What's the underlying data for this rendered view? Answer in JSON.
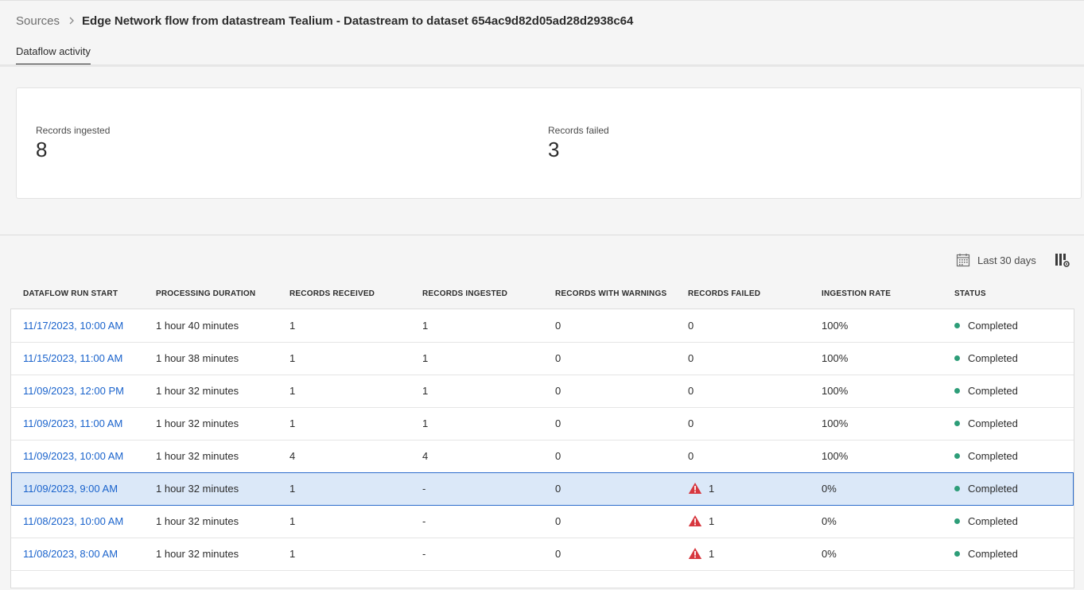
{
  "breadcrumb": {
    "root": "Sources",
    "current": "Edge Network flow from datastream Tealium - Datastream to dataset 654ac9d82d05ad28d2938c64"
  },
  "tabs": [
    {
      "label": "Dataflow activity",
      "active": true
    }
  ],
  "summary": {
    "records_ingested": {
      "label": "Records ingested",
      "value": "8"
    },
    "records_failed": {
      "label": "Records failed",
      "value": "3"
    }
  },
  "toolbar": {
    "date_range": "Last 30 days",
    "icons": [
      "calendar-icon",
      "column-settings-icon"
    ]
  },
  "table": {
    "columns": [
      "DATAFLOW RUN START",
      "PROCESSING DURATION",
      "RECORDS RECEIVED",
      "RECORDS INGESTED",
      "RECORDS WITH WARNINGS",
      "RECORDS FAILED",
      "INGESTION RATE",
      "STATUS"
    ],
    "rows": [
      {
        "start": "11/17/2023, 10:00 AM",
        "duration": "1 hour 40 minutes",
        "received": "1",
        "ingested": "1",
        "warnings": "0",
        "failed": "0",
        "failed_alert": false,
        "rate": "100%",
        "status": "Completed"
      },
      {
        "start": "11/15/2023, 11:00 AM",
        "duration": "1 hour 38 minutes",
        "received": "1",
        "ingested": "1",
        "warnings": "0",
        "failed": "0",
        "failed_alert": false,
        "rate": "100%",
        "status": "Completed"
      },
      {
        "start": "11/09/2023, 12:00 PM",
        "duration": "1 hour 32 minutes",
        "received": "1",
        "ingested": "1",
        "warnings": "0",
        "failed": "0",
        "failed_alert": false,
        "rate": "100%",
        "status": "Completed"
      },
      {
        "start": "11/09/2023, 11:00 AM",
        "duration": "1 hour 32 minutes",
        "received": "1",
        "ingested": "1",
        "warnings": "0",
        "failed": "0",
        "failed_alert": false,
        "rate": "100%",
        "status": "Completed"
      },
      {
        "start": "11/09/2023, 10:00 AM",
        "duration": "1 hour 32 minutes",
        "received": "4",
        "ingested": "4",
        "warnings": "0",
        "failed": "0",
        "failed_alert": false,
        "rate": "100%",
        "status": "Completed"
      },
      {
        "start": "11/09/2023, 9:00 AM",
        "duration": "1 hour 32 minutes",
        "received": "1",
        "ingested": "-",
        "warnings": "0",
        "failed": "1",
        "failed_alert": true,
        "rate": "0%",
        "status": "Completed",
        "selected": true
      },
      {
        "start": "11/08/2023, 10:00 AM",
        "duration": "1 hour 32 minutes",
        "received": "1",
        "ingested": "-",
        "warnings": "0",
        "failed": "1",
        "failed_alert": true,
        "rate": "0%",
        "status": "Completed"
      },
      {
        "start": "11/08/2023, 8:00 AM",
        "duration": "1 hour 32 minutes",
        "received": "1",
        "ingested": "-",
        "warnings": "0",
        "failed": "1",
        "failed_alert": true,
        "rate": "0%",
        "status": "Completed"
      }
    ]
  },
  "colors": {
    "link": "#1a63cc",
    "status_success": "#2d9d78",
    "alert": "#d7373f",
    "selected_row": "#dbe8f8",
    "selected_border": "#2c6ccc"
  }
}
